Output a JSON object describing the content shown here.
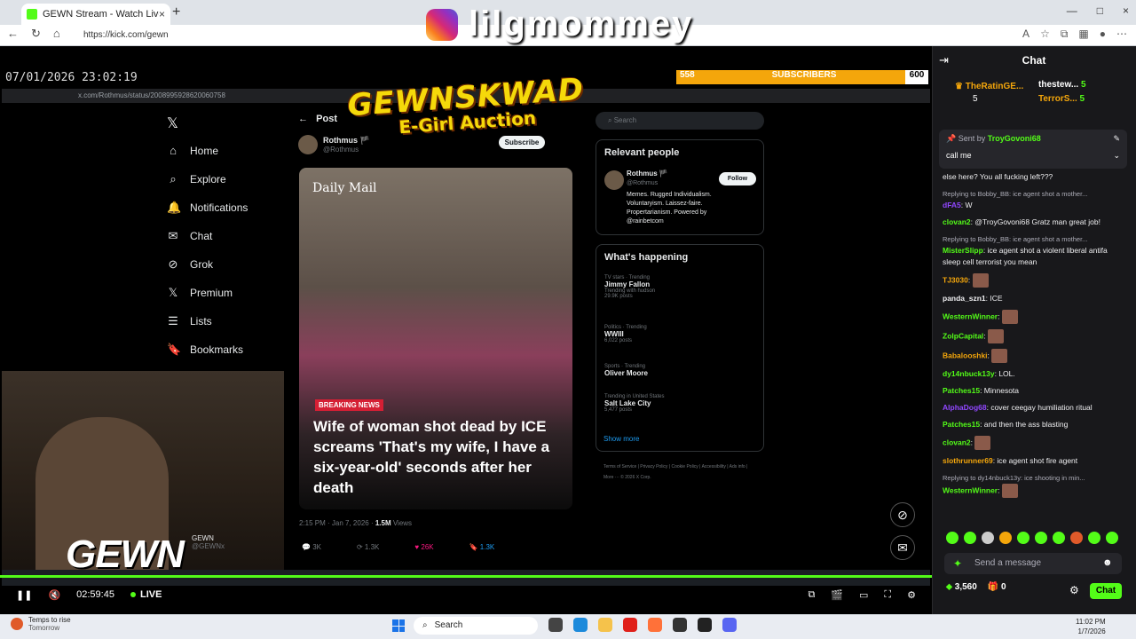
{
  "browser": {
    "tab_title": "GEWN Stream - Watch Live on Kick",
    "tab_close": "×",
    "new_tab": "+",
    "url": "https://kick.com/gewn",
    "window_controls": [
      "—",
      "□",
      "×"
    ]
  },
  "overlay": {
    "instagram_handle": "lilgmommey",
    "clock": "07/01/2026 23:02:19",
    "sub_left": "558",
    "sub_label": "SUBSCRIBERS",
    "sub_right": "600",
    "title_line1": "GEWNSKWAD",
    "title_line2": "E-Girl Auction",
    "logo": "GEWN"
  },
  "inner_browser": {
    "url": "x.com/Rothmus/status/2008995928620060758"
  },
  "x_page": {
    "logo": "𝕏",
    "nav": [
      {
        "icon": "⌂",
        "label": "Home"
      },
      {
        "icon": "⌕",
        "label": "Explore"
      },
      {
        "icon": "🔔",
        "label": "Notifications"
      },
      {
        "icon": "✉",
        "label": "Chat"
      },
      {
        "icon": "⊘",
        "label": "Grok"
      },
      {
        "icon": "𝕏",
        "label": "Premium"
      },
      {
        "icon": "☰",
        "label": "Lists"
      },
      {
        "icon": "🔖",
        "label": "Bookmarks"
      }
    ],
    "post_header": "Post",
    "author_name": "Rothmus 🏴",
    "author_handle": "@Rothmus",
    "subscribe": "Subscribe",
    "image_source": "Daily Mail",
    "breaking": "BREAKING NEWS",
    "headline": "Wife of woman shot dead by ICE screams 'That's my wife, I have a six-year-old' seconds after her death",
    "meta_time": "2:15 PM · Jan 7, 2026 · ",
    "meta_views_num": "1.5M",
    "meta_views": " Views",
    "actions": [
      "3K",
      "1.3K",
      "26K",
      "1.3K"
    ],
    "search_placeholder": "Search",
    "relevant_title": "Relevant people",
    "rel_name": "Rothmus 🏴",
    "rel_handle": "@Rothmus",
    "rel_bio": "Memes. Rugged Individualism. Voluntaryism. Laissez-faire. Propertarianism. Powered by @rainbetcom",
    "follow": "Follow",
    "happening_title": "What's happening",
    "trends": [
      {
        "ctx": "TV stars · Trending",
        "name": "Jimmy Fallon",
        "extra": "Trending with hudson",
        "posts": "29.9K posts"
      },
      {
        "ctx": "Politics · Trending",
        "name": "WWIII",
        "extra": "",
        "posts": "6,022 posts"
      },
      {
        "ctx": "Sports · Trending",
        "name": "Oliver Moore",
        "extra": "",
        "posts": ""
      },
      {
        "ctx": "Trending in United States",
        "name": "Salt Lake City",
        "extra": "",
        "posts": "5,477 posts"
      }
    ],
    "show_more": "Show more",
    "footer": "Terms of Service | Privacy Policy | Cookie Policy | Accessibility | Ads info | More ··· © 2026 X Corp.",
    "bottom_user": "GEWN",
    "bottom_handle": "@GEWNx"
  },
  "player": {
    "time": "02:59:45",
    "live": "LIVE"
  },
  "chat": {
    "title": "Chat",
    "gifters": [
      {
        "name": "TheRatinGE...",
        "count": "5"
      },
      {
        "name": "thestew...",
        "count": "5"
      },
      {
        "name": "TerrorS...",
        "count": "5"
      }
    ],
    "pinned_sent": "Sent by",
    "pinned_user": "TroyGovoni68",
    "pinned_msg": "call me",
    "messages": [
      {
        "reply": "",
        "user": "",
        "color": "#efeff1",
        "text": "else here? You all fucking left???"
      },
      {
        "reply": "Replying to Bobby_BB: ice agent shot a mother...",
        "user": "dFA5",
        "color": "#9147ff",
        "text": "W"
      },
      {
        "reply": "",
        "user": "clovan2",
        "color": "#53fc18",
        "text": "@TroyGovoni68 Gratz man great job!"
      },
      {
        "reply": "Replying to Bobby_BB: ice agent shot a mother...",
        "user": "MisterSlipp",
        "color": "#53fc18",
        "text": "ice agent shot a violent liberal antifa sleep cell terrorist you mean"
      },
      {
        "reply": "",
        "user": "TJ3030",
        "color": "#f4a60b",
        "text": ""
      },
      {
        "reply": "",
        "user": "panda_szn1",
        "color": "#efeff1",
        "text": "ICE"
      },
      {
        "reply": "",
        "user": "WesternWinner",
        "color": "#53fc18",
        "text": ""
      },
      {
        "reply": "",
        "user": "ZolpCapital",
        "color": "#53fc18",
        "text": ""
      },
      {
        "reply": "",
        "user": "Babalooshki",
        "color": "#f4a60b",
        "text": ""
      },
      {
        "reply": "",
        "user": "dy14nbuck13y",
        "color": "#53fc18",
        "text": "LOL."
      },
      {
        "reply": "",
        "user": "Patches15",
        "color": "#53fc18",
        "text": "Minnesota"
      },
      {
        "reply": "",
        "user": "AlphaDog68",
        "color": "#9147ff",
        "text": "cover ceegay humiliation ritual"
      },
      {
        "reply": "",
        "user": "Patches15",
        "color": "#53fc18",
        "text": "and then the ass blasting"
      },
      {
        "reply": "",
        "user": "clovan2",
        "color": "#53fc18",
        "text": ""
      },
      {
        "reply": "",
        "user": "slothrunner69",
        "color": "#f4a60b",
        "text": "ice agent shot fire agent"
      },
      {
        "reply": "Replying to dy14nbuck13y: ice shooting in min...",
        "user": "WesternWinner",
        "color": "#53fc18",
        "text": ""
      }
    ],
    "input_placeholder": "Send a message",
    "viewers": "3,560",
    "points": "0",
    "chat_button": "Chat"
  },
  "taskbar": {
    "weather_title": "Temps to rise",
    "weather_sub": "Tomorrow",
    "search": "Search",
    "time": "11:02 PM",
    "date": "1/7/2026"
  }
}
